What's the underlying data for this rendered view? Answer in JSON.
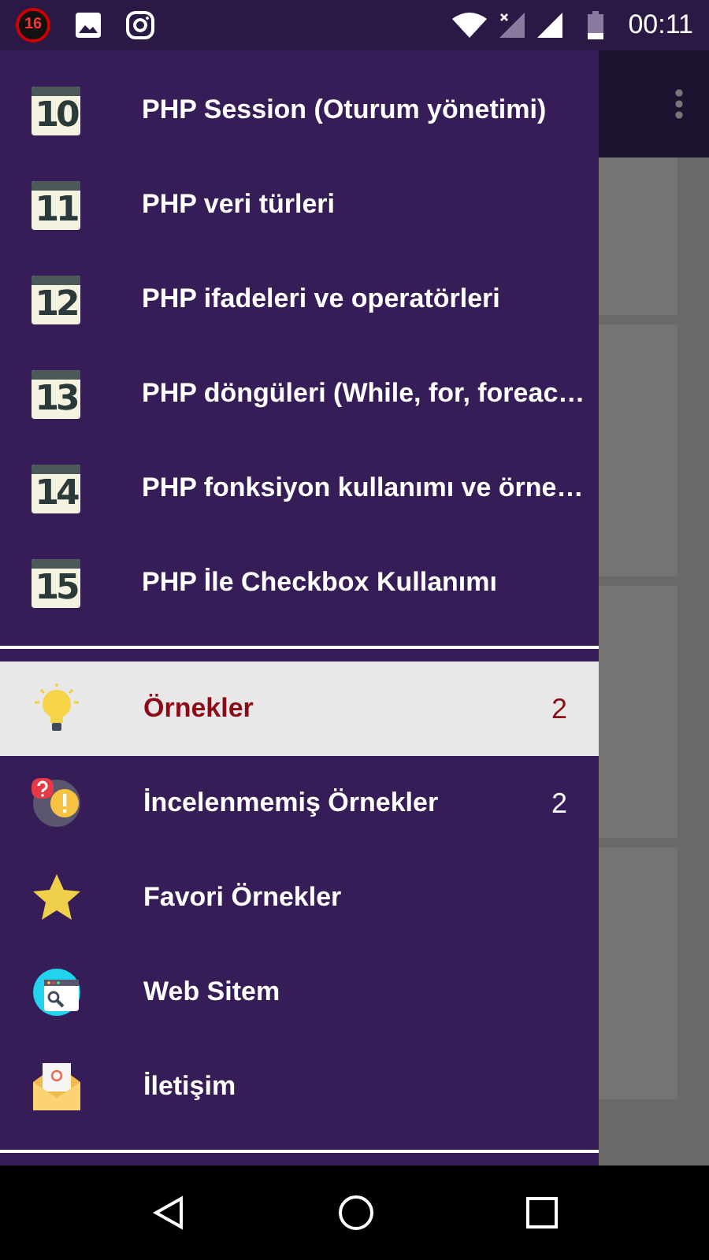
{
  "status_bar": {
    "notification_count": "16",
    "time": "00:11"
  },
  "lessons": [
    {
      "number": "10",
      "title": "PHP Session (Oturum yönetimi)"
    },
    {
      "number": "11",
      "title": "PHP veri türleri"
    },
    {
      "number": "12",
      "title": "PHP ifadeleri ve operatörleri"
    },
    {
      "number": "13",
      "title": "PHP döngüleri (While, for, foreac…"
    },
    {
      "number": "14",
      "title": "PHP fonksiyon kullanımı ve örne…"
    },
    {
      "number": "15",
      "title": "PHP İle Checkbox Kullanımı"
    }
  ],
  "menu": [
    {
      "kind": "bulb",
      "label": "Örnekler",
      "count": "2",
      "selected": true
    },
    {
      "kind": "alert",
      "label": "İncelenmemiş Örnekler",
      "count": "2",
      "selected": false
    },
    {
      "kind": "star",
      "label": "Favori Örnekler",
      "selected": false
    },
    {
      "kind": "web",
      "label": "Web Sitem",
      "selected": false
    },
    {
      "kind": "mail",
      "label": "İletişim",
      "selected": false
    }
  ]
}
